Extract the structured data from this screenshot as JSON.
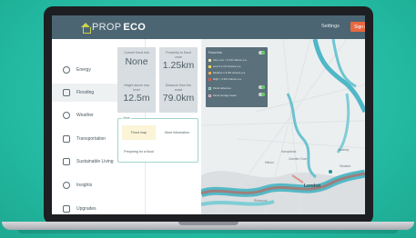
{
  "app": {
    "logo_prefix": "PROP",
    "logo_suffix": "ECO",
    "settings_label": "Settings",
    "signin_label": "Sign in"
  },
  "sidebar": {
    "items": [
      {
        "label": "Energy",
        "icon": "bulb-icon"
      },
      {
        "label": "Flooding",
        "icon": "house-flood-icon"
      },
      {
        "label": "Weather",
        "icon": "cloud-icon"
      },
      {
        "label": "Transportation",
        "icon": "car-icon"
      },
      {
        "label": "Sustainable Living",
        "icon": "tree-icon"
      },
      {
        "label": "Insights",
        "icon": "info-icon"
      },
      {
        "label": "Upgrades",
        "icon": "leaf-icon"
      }
    ],
    "active_index": 1
  },
  "stats": {
    "flood_risk": {
      "label": "Current flood risk",
      "value": "None"
    },
    "proximity": {
      "label": "Proximity to flood zone",
      "value": "1.25km"
    },
    "height": {
      "label": "Height above sea level",
      "value": "12.5m"
    },
    "distance_coast": {
      "label": "Distance from the coast",
      "value": "79.0km"
    }
  },
  "views": {
    "title": "View",
    "flood_map": "Flood map",
    "more_info": "More information",
    "preparing": "Preparing for a flood"
  },
  "legend": {
    "title": "Flood risk",
    "rows": [
      {
        "label": "Very Low < 0.1% chance p.a.",
        "color": "#e9e2a6"
      },
      {
        "label": "Low 0.1-1% chance p.a.",
        "color": "#f2d04b"
      },
      {
        "label": "Medium 1-3.3% chance p.a.",
        "color": "#f0a44a"
      },
      {
        "label": "High > 3.3% chance p.a.",
        "color": "#d9503f"
      }
    ],
    "defences": "Flood defences",
    "storage": "Flood storage areas"
  },
  "map": {
    "places": [
      "Hampstead",
      "Kilburn",
      "Camden Town",
      "Hackney",
      "Stratford",
      "Richmond"
    ],
    "city": "London"
  }
}
